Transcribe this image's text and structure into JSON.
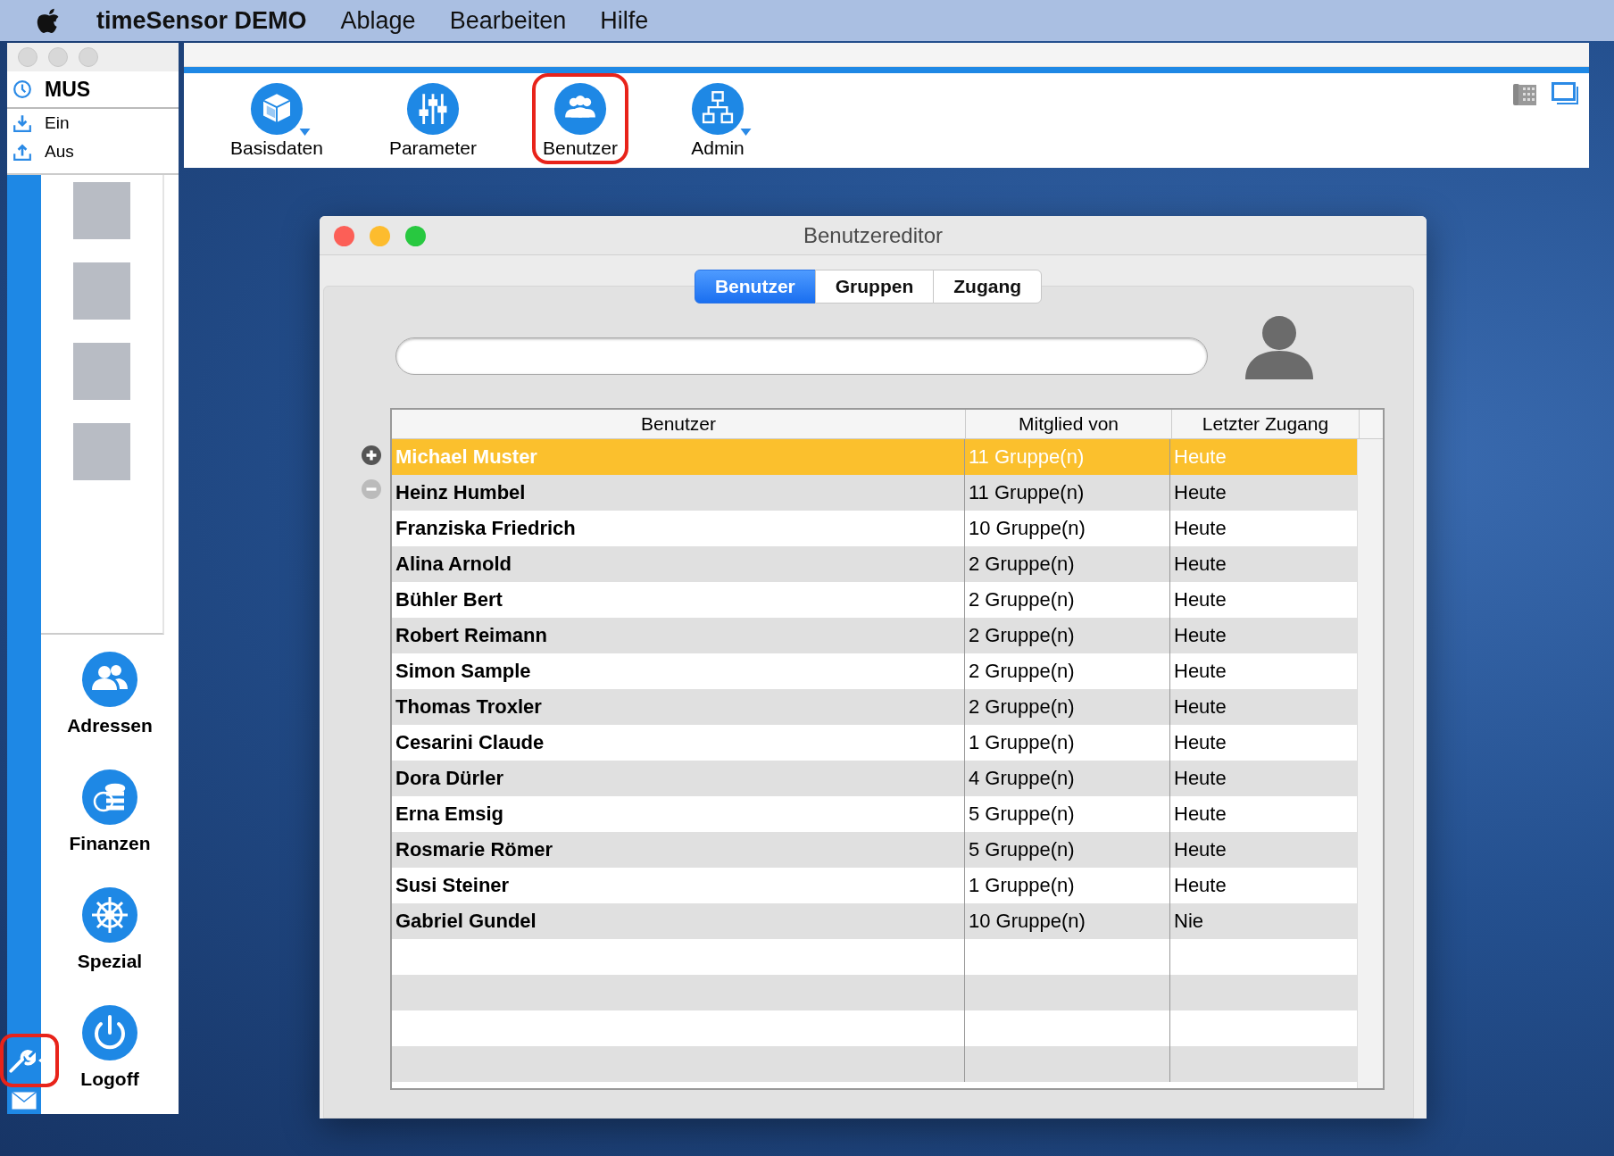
{
  "menubar": {
    "app": "timeSensor DEMO",
    "menus": [
      "Ablage",
      "Bearbeiten",
      "Hilfe"
    ]
  },
  "side_panel": {
    "user": "MUS",
    "actions": [
      {
        "label": "Ein"
      },
      {
        "label": "Aus"
      }
    ],
    "nav": [
      {
        "label": "Adressen"
      },
      {
        "label": "Finanzen"
      },
      {
        "label": "Spezial"
      },
      {
        "label": "Logoff"
      }
    ],
    "tool_highlighted": true
  },
  "toolbar": {
    "items": [
      {
        "label": "Basisdaten",
        "dropdown": true,
        "highlighted": false
      },
      {
        "label": "Parameter",
        "dropdown": false,
        "highlighted": false
      },
      {
        "label": "Benutzer",
        "dropdown": false,
        "highlighted": true
      },
      {
        "label": "Admin",
        "dropdown": true,
        "highlighted": false
      }
    ]
  },
  "dialog": {
    "title": "Benutzereditor",
    "tabs": [
      {
        "label": "Benutzer",
        "selected": true
      },
      {
        "label": "Gruppen",
        "selected": false
      },
      {
        "label": "Zugang",
        "selected": false
      }
    ],
    "table": {
      "columns": [
        "Benutzer",
        "Mitglied von",
        "Letzter Zugang"
      ],
      "rows": [
        {
          "cells": [
            "Michael Muster",
            "11 Gruppe(n)",
            "Heute"
          ],
          "selected": true
        },
        {
          "cells": [
            "Heinz Humbel",
            "11 Gruppe(n)",
            "Heute"
          ],
          "selected": false
        },
        {
          "cells": [
            "Franziska Friedrich",
            "10 Gruppe(n)",
            "Heute"
          ],
          "selected": false
        },
        {
          "cells": [
            "Alina Arnold",
            "2 Gruppe(n)",
            "Heute"
          ],
          "selected": false
        },
        {
          "cells": [
            "Bühler Bert",
            "2 Gruppe(n)",
            "Heute"
          ],
          "selected": false
        },
        {
          "cells": [
            "Robert Reimann",
            "2 Gruppe(n)",
            "Heute"
          ],
          "selected": false
        },
        {
          "cells": [
            "Simon Sample",
            "2 Gruppe(n)",
            "Heute"
          ],
          "selected": false
        },
        {
          "cells": [
            "Thomas Troxler",
            "2 Gruppe(n)",
            "Heute"
          ],
          "selected": false
        },
        {
          "cells": [
            "Cesarini Claude",
            "1 Gruppe(n)",
            "Heute"
          ],
          "selected": false
        },
        {
          "cells": [
            "Dora Dürler",
            "4 Gruppe(n)",
            "Heute"
          ],
          "selected": false
        },
        {
          "cells": [
            "Erna Emsig",
            "5 Gruppe(n)",
            "Heute"
          ],
          "selected": false
        },
        {
          "cells": [
            "Rosmarie Römer",
            "5 Gruppe(n)",
            "Heute"
          ],
          "selected": false
        },
        {
          "cells": [
            "Susi Steiner",
            "1 Gruppe(n)",
            "Heute"
          ],
          "selected": false
        },
        {
          "cells": [
            "Gabriel Gundel",
            "10 Gruppe(n)",
            "Nie"
          ],
          "selected": false
        }
      ]
    }
  }
}
